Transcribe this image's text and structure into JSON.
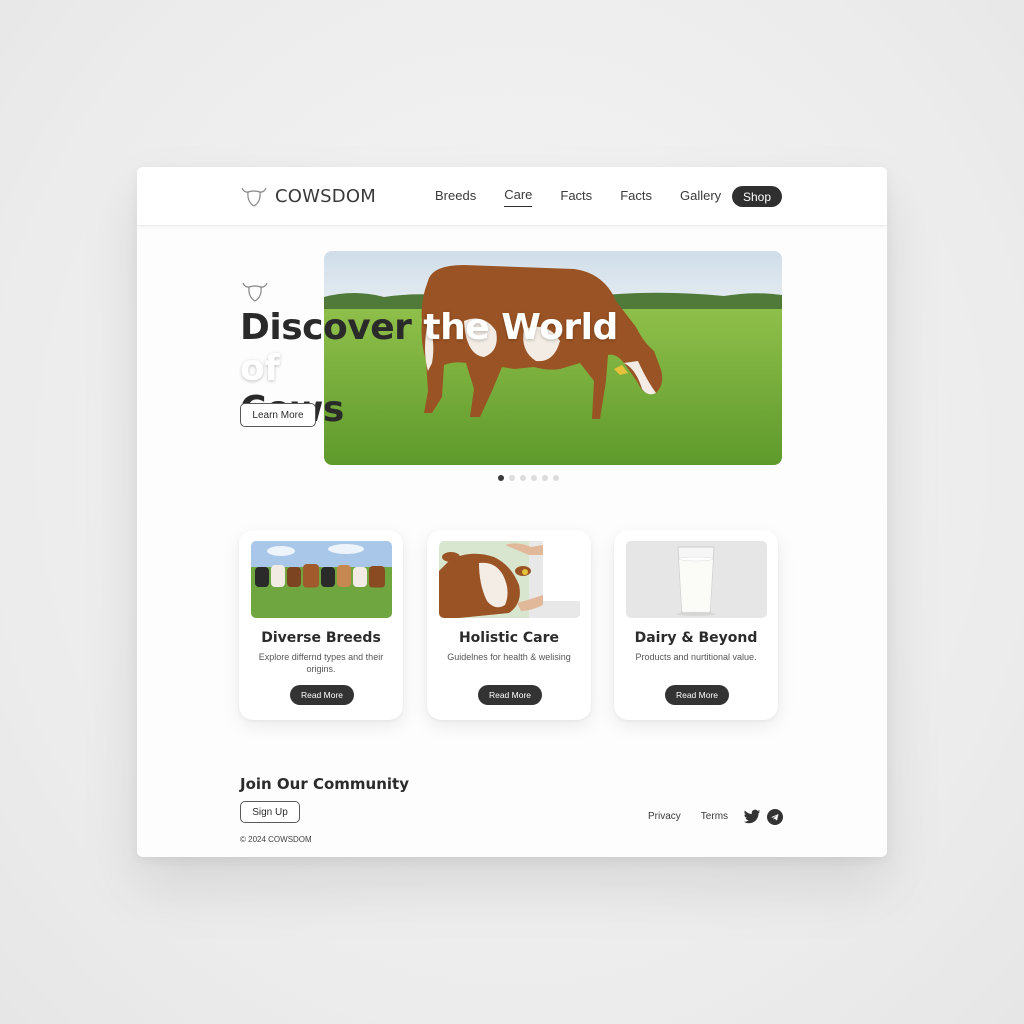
{
  "brand": {
    "name": "COWSDOM"
  },
  "nav": {
    "items": [
      {
        "label": "Breeds",
        "active": false
      },
      {
        "label": "Care",
        "active": true
      },
      {
        "label": "Facts",
        "active": false
      },
      {
        "label": "Facts",
        "active": false
      },
      {
        "label": "Gallery",
        "active": false
      }
    ],
    "shop_label": "Shop"
  },
  "hero": {
    "title_line1_part1": "Discover ",
    "title_line1_part2": "the World of",
    "title_line2": "Cows",
    "button_label": "Learn More",
    "image": "cow-grazing-photo",
    "carousel": {
      "total": 6,
      "active": 1
    }
  },
  "cards": [
    {
      "title": "Diverse Breeds",
      "description": "Explore differnd types and their origins.",
      "button": "Read More",
      "image": "herd-of-cows-photo"
    },
    {
      "title": "Holistic Care",
      "description": "Guidelnes for health & welising",
      "button": "Read More",
      "image": "cow-being-cared-photo"
    },
    {
      "title": "Dairy & Beyond",
      "description": "Products and nurtitional value.",
      "button": "Read More",
      "image": "glass-of-milk-photo"
    }
  ],
  "footer": {
    "community_heading": "Join Our Community",
    "signup_label": "Sign Up",
    "copyright": "© 2024 COWSDOM",
    "links": [
      "Privacy",
      "Terms"
    ],
    "social_icons": [
      "twitter-icon",
      "telegram-icon"
    ]
  },
  "colors": {
    "dark": "#2f2f2f",
    "background": "#ececec",
    "card": "#ffffff"
  }
}
